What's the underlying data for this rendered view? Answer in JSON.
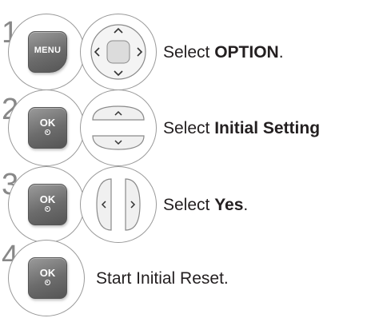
{
  "steps": [
    {
      "number": "1",
      "key_label": "MENU",
      "text_prefix": "Select ",
      "text_bold": "OPTION",
      "text_suffix": ".",
      "nav": "dpad"
    },
    {
      "number": "2",
      "key_label": "OK",
      "text_prefix": "Select ",
      "text_bold": "Initial Setting",
      "text_suffix": "",
      "nav": "up-down"
    },
    {
      "number": "3",
      "key_label": "OK",
      "text_prefix": "Select ",
      "text_bold": "Yes",
      "text_suffix": ".",
      "nav": "left-right"
    },
    {
      "number": "4",
      "key_label": "OK",
      "text_prefix": "Start Initial Reset.",
      "text_bold": "",
      "text_suffix": "",
      "nav": ""
    }
  ],
  "icons": {
    "step1_nav": "dpad-icon",
    "step2_nav": "up-down-arrows-icon",
    "step3_nav": "left-right-arrows-icon",
    "ok_symbol": "ok-dot-icon"
  },
  "colors": {
    "text": "#231f20",
    "step_number": "#888888",
    "key": "#6c6c6c"
  }
}
